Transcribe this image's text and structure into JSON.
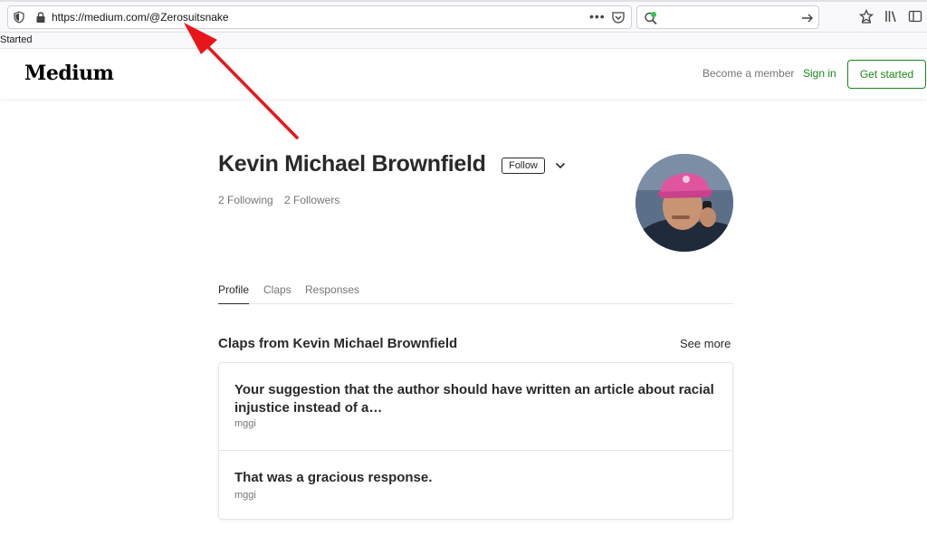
{
  "browser": {
    "url": "https://medium.com/@Zerosuitsnake",
    "overflow_menu": "•••",
    "bookmark_label": "Started"
  },
  "header": {
    "logo": "Medium",
    "become_member": "Become a member",
    "sign_in": "Sign in",
    "get_started": "Get started"
  },
  "profile": {
    "name": "Kevin Michael Brownfield",
    "follow_label": "Follow",
    "following": "2 Following",
    "followers": "2 Followers"
  },
  "tabs": [
    {
      "label": "Profile",
      "active": true
    },
    {
      "label": "Claps",
      "active": false
    },
    {
      "label": "Responses",
      "active": false
    }
  ],
  "claps": {
    "title": "Claps from Kevin Michael Brownfield",
    "see_more": "See more",
    "items": [
      {
        "title": "Your suggestion that the author should have written an article about racial injustice instead of a…",
        "author": "mggi"
      },
      {
        "title": "That was a gracious response.",
        "author": "mggi"
      }
    ]
  },
  "colors": {
    "brand_green": "#1a8917",
    "annotation_red": "#e8161b"
  }
}
